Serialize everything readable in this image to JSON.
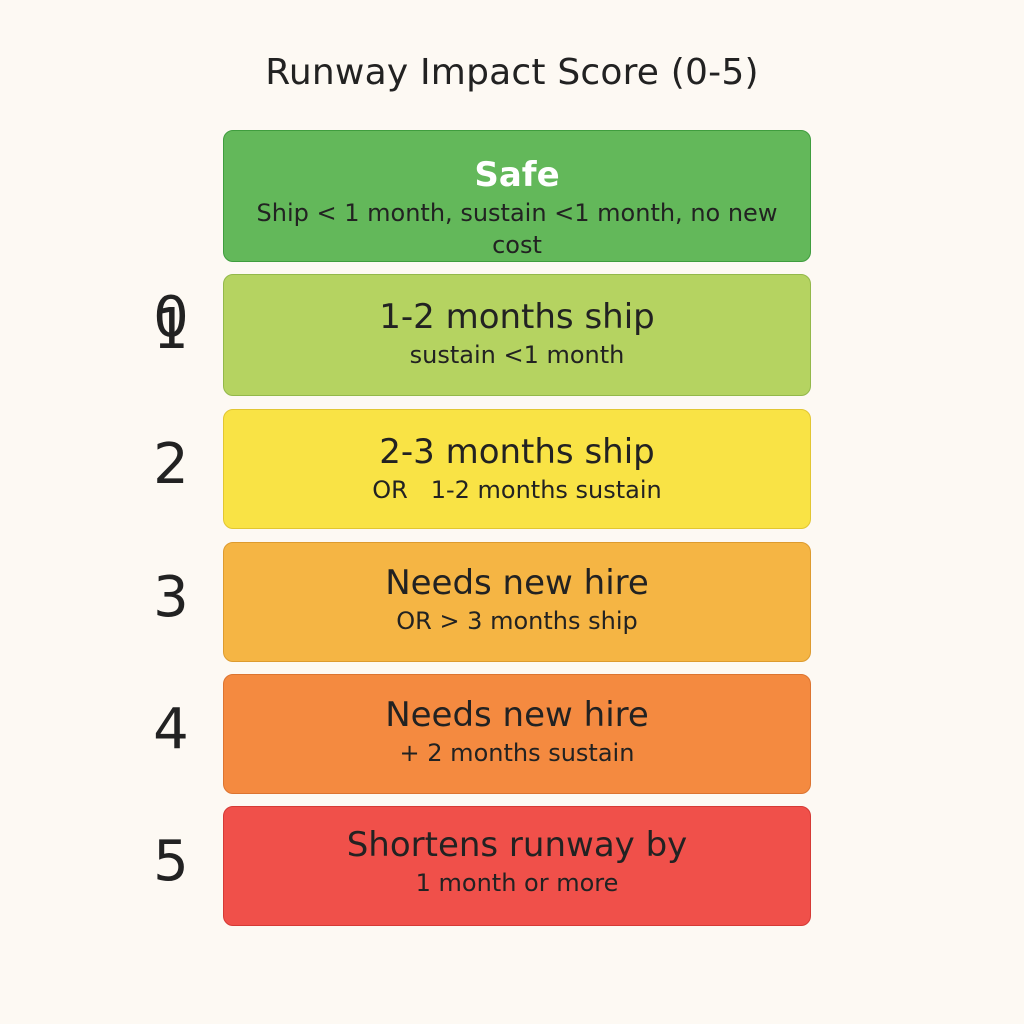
{
  "title": "Runway Impact Score (0-5)",
  "levels": [
    {
      "score": "0",
      "headline": "Safe",
      "detail": "Ship < 1 month, sustain <1 month, no new cost",
      "color": "#63b85a"
    },
    {
      "score": "1",
      "headline": "1-2 months ship",
      "detail": "sustain <1 month",
      "color": "#b5d361"
    },
    {
      "score": "2",
      "headline": "2-3 months ship",
      "detail": "OR   1-2 months sustain",
      "color": "#f9e345"
    },
    {
      "score": "3",
      "headline": "Needs new hire",
      "detail": "OR > 3 months ship",
      "color": "#f5b544"
    },
    {
      "score": "4",
      "headline": "Needs new hire",
      "detail": "+ 2 months sustain",
      "color": "#f48a40"
    },
    {
      "score": "5",
      "headline": "Shortens runway by",
      "detail": "1 month or more",
      "color": "#f0504a"
    }
  ]
}
